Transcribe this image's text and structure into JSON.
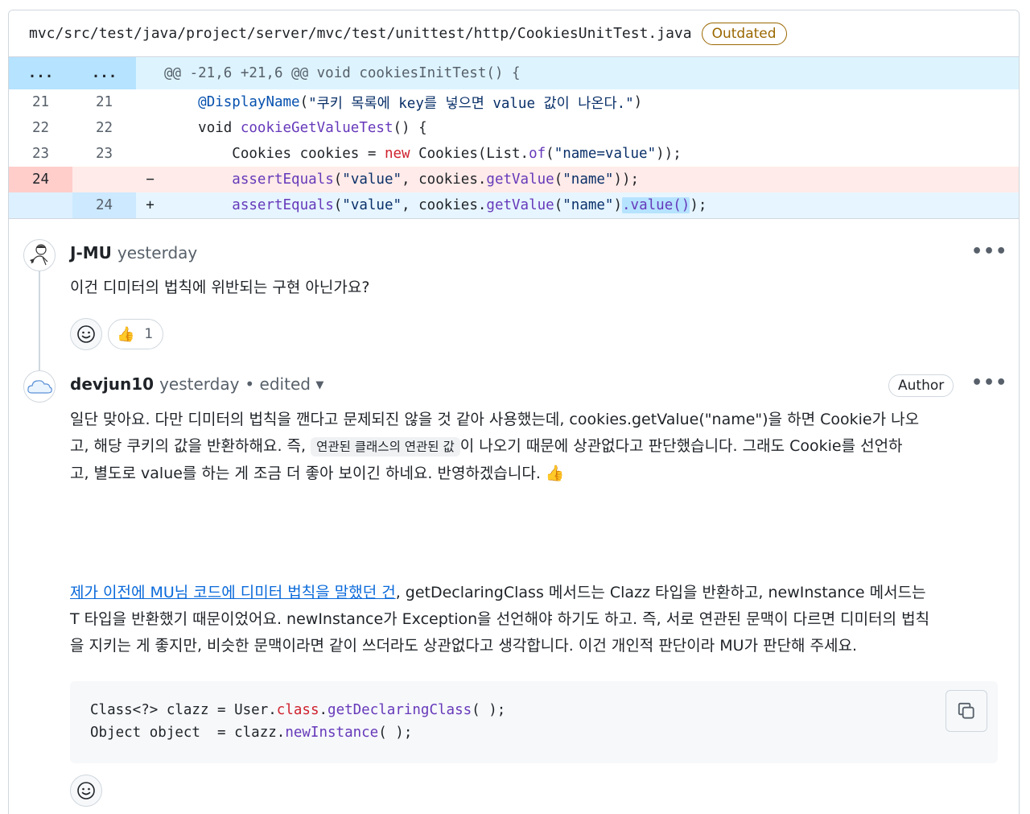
{
  "file": {
    "path": "mvc/src/test/java/project/server/mvc/test/unittest/http/CookiesUnitTest.java",
    "badge": "Outdated"
  },
  "diff": {
    "hunk": {
      "old": "...",
      "new": "...",
      "text": "@@ -21,6 +21,6 @@ void cookiesInitTest() {"
    },
    "lines": [
      {
        "type": "ctx",
        "old": "21",
        "new": "21",
        "marker": ""
      },
      {
        "type": "ctx",
        "old": "22",
        "new": "22",
        "marker": ""
      },
      {
        "type": "ctx",
        "old": "23",
        "new": "23",
        "marker": ""
      },
      {
        "type": "del",
        "old": "24",
        "new": "",
        "marker": "−"
      },
      {
        "type": "add",
        "old": "",
        "new": "24",
        "marker": "+"
      }
    ],
    "code": {
      "l21": {
        "indent": "    ",
        "annotation": "@DisplayName",
        "paren_open": "(",
        "string": "\"쿠키 목록에 key를 넣으면 value 값이 나온다.\"",
        "paren_close": ")"
      },
      "l22": {
        "indent": "    ",
        "void": "void ",
        "method": "cookieGetValueTest",
        "rest": "() {"
      },
      "l23": {
        "indent": "        ",
        "type": "Cookies cookies = ",
        "new": "new",
        "ctor": " Cookies(List.",
        "of": "of",
        "args_open": "(",
        "str": "\"name=value\"",
        "end": "));"
      },
      "l24_del": {
        "indent": "        ",
        "fn": "assertEquals",
        "p1": "(",
        "s1": "\"value\"",
        "mid": ", cookies.",
        "fn2": "getValue",
        "p2": "(",
        "s2": "\"name\"",
        "end": "));"
      },
      "l24_add": {
        "indent": "        ",
        "fn": "assertEquals",
        "p1": "(",
        "s1": "\"value\"",
        "mid": ", cookies.",
        "fn2": "getValue",
        "p2": "(",
        "s2": "\"name\"",
        "close": ")",
        "hl": ".value()",
        "end": ");"
      }
    }
  },
  "comments": [
    {
      "author": "J-MU",
      "time": "yesterday",
      "body": "이건 디미터의 법칙에 위반되는 구현 아닌가요?",
      "reaction_count": "1"
    },
    {
      "author": "devjun10",
      "time": "yesterday",
      "edited": "• edited",
      "badge": "Author",
      "p1_a": "일단 맞아요. 다만 디미터의 법칙을 깬다고 문제되진 않을 것 같아 사용했는데, cookies.getValue(\"name\")을 하면 Cookie가 나오",
      "p1_b": "고, 해당 쿠키의 값을 반환하해요. 즉, ",
      "p1_code": "연관된 클래스의 연관된 값",
      "p1_c": "이 나오기 때문에 상관없다고 판단했습니다. 그래도 Cookie를 선언하",
      "p1_d": "고, 별도로 value를 하는 게 조금 더 좋아 보이긴 하네요. 반영하겠습니다. 👍",
      "p2_link": "제가 이전에 MU님 코드에 디미터 법칙을 말했던 건",
      "p2_a": ", getDeclaringClass 메서드는 Clazz 타입을 반환하고, newInstance 메서드는",
      "p2_b": "T 타입을 반환했기 때문이었어요. newInstance가 Exception을 선언해야 하기도 하고. 즉, 서로 연관된 문맥이 다르면 디미터의 법칙",
      "p2_c": "을 지키는 게 좋지만, 비슷한 문맥이라면 같이 쓰더라도 상관없다고 생각합니다. 이건 개인적 판단이라 MU가 판단해 주세요.",
      "code": {
        "l1_a": "Class<?> clazz = User.",
        "l1_kw": "class",
        "l1_b": ".",
        "l1_fn": "getDeclaringClass",
        "l1_c": "( );",
        "l2_a": "Object object  = clazz.",
        "l2_fn": "newInstance",
        "l2_b": "( );"
      }
    }
  ]
}
